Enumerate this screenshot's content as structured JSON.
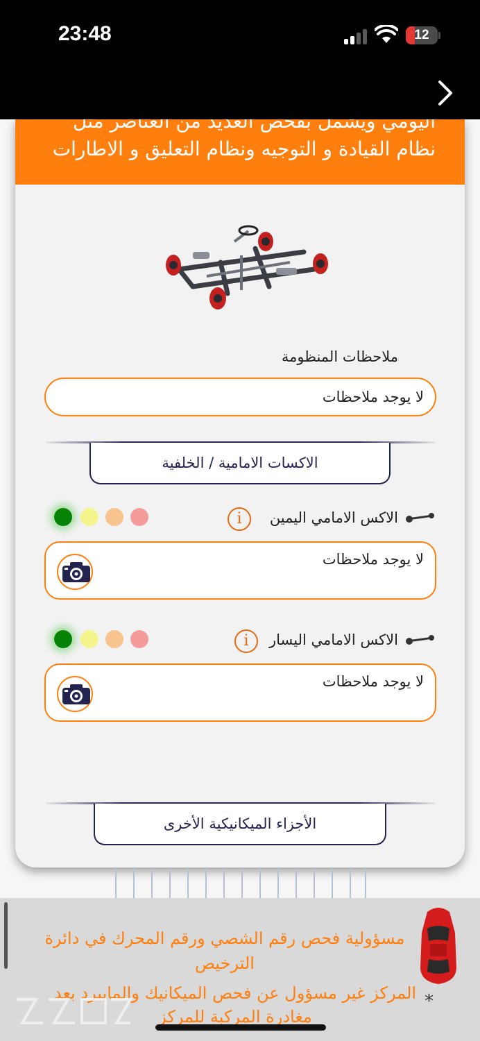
{
  "status_bar": {
    "time": "23:48",
    "battery": "12"
  },
  "header": {
    "line1": "اليومي ويشمل بفحص العديد من العناصر مثل",
    "line2": "نظام القيادة و التوجيه ونظام التعليق و الاطارات"
  },
  "system_notes": {
    "label": "ملاحظات المنظومة",
    "value": "لا يوجد ملاحظات"
  },
  "section_axles": {
    "title": "الاكسات الامامية / الخلفية"
  },
  "items": [
    {
      "label": "الاكس الامامي اليمين",
      "note": "لا يوجد ملاحظات",
      "status": "green"
    },
    {
      "label": "الاكس الامامي اليسار",
      "note": "لا يوجد ملاحظات",
      "status": "green"
    }
  ],
  "section_other": {
    "title": "الأجزاء الميكانيكية الأخرى"
  },
  "footer": {
    "line1": "مسؤولية فحص رقم الشصي ورقم المحرك في دائرة الترخيص",
    "line2": "المركز غير مسؤول عن فحص الميكانيك والمايبرد بعد مغادرة المركبة للمركز",
    "star": "*"
  },
  "colors": {
    "accent": "#fe7f0d",
    "navy": "#232350",
    "green": "#078307"
  },
  "icons": [
    "chevron-right-icon",
    "info-icon",
    "camera-icon",
    "axle-icon",
    "car-icon",
    "wifi-icon",
    "signal-icon",
    "battery-icon"
  ]
}
